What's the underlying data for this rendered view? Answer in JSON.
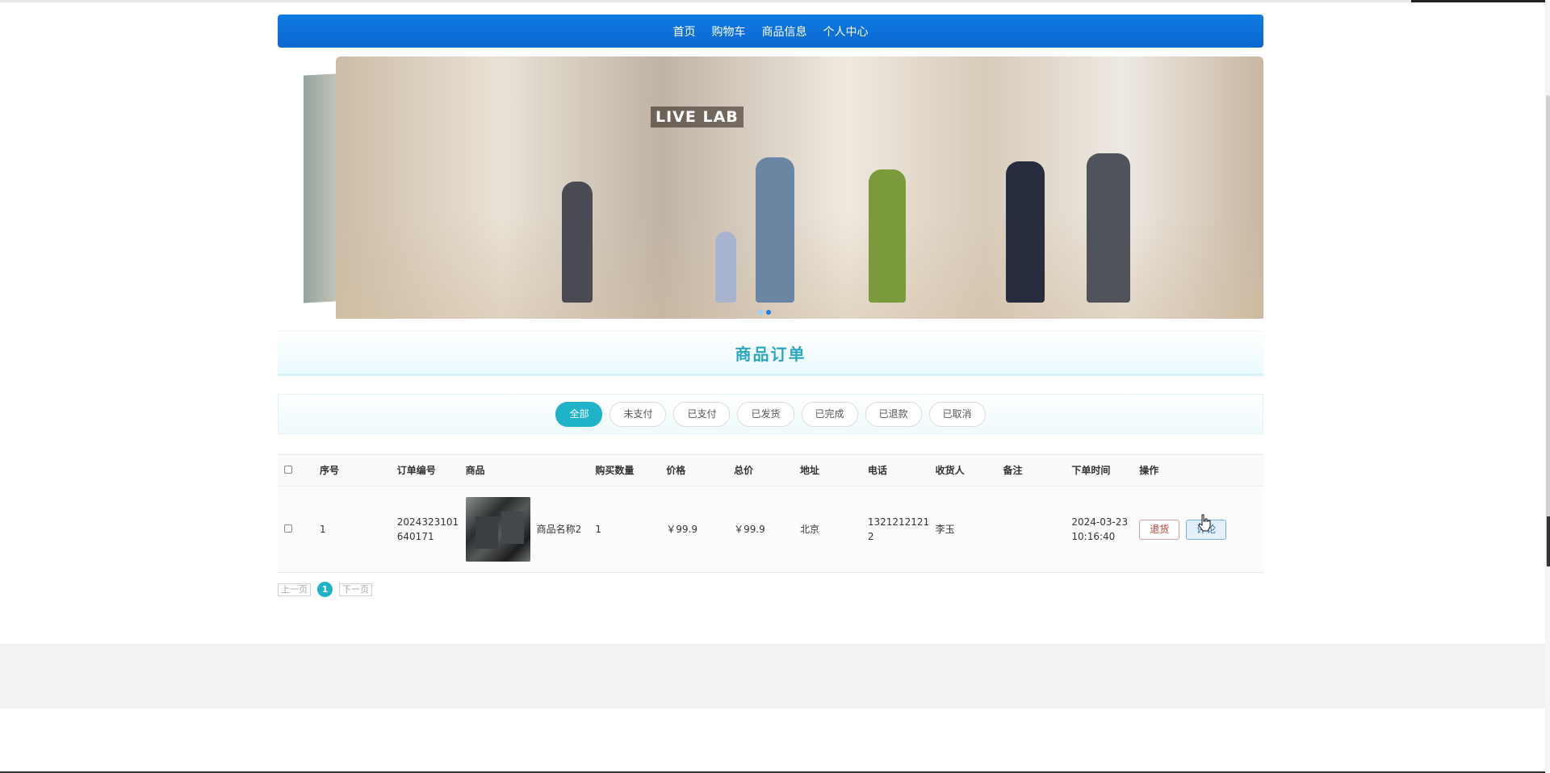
{
  "nav": {
    "items": [
      "首页",
      "购物车",
      "商品信息",
      "个人中心"
    ]
  },
  "banner": {
    "sign_text": "LIVE LAB",
    "dots": 2,
    "active_dot": 1
  },
  "section": {
    "title": "商品订单"
  },
  "tabs": {
    "items": [
      "全部",
      "未支付",
      "已支付",
      "已发货",
      "已完成",
      "已退款",
      "已取消"
    ],
    "active": "全部"
  },
  "table": {
    "headers": [
      "序号",
      "订单编号",
      "商品",
      "购买数量",
      "价格",
      "总价",
      "地址",
      "电话",
      "收货人",
      "备注",
      "下单时间",
      "操作"
    ],
    "rows": [
      {
        "index": "1",
        "order_no": "2024323101640171",
        "product_name": "商品名称2",
        "quantity": "1",
        "price": "￥99.9",
        "total": "￥99.9",
        "address": "北京",
        "phone": "13212121212",
        "receiver": "李玉",
        "remark": "",
        "order_time": "2024-03-23 10:16:40",
        "refund_label": "退货",
        "review_label": "评论"
      }
    ]
  },
  "pager": {
    "prev": "上一页",
    "current": "1",
    "next": "下一页"
  },
  "colors": {
    "nav": "#0a6fd6",
    "accent": "#1fb3c9",
    "title": "#2aa7c0"
  }
}
